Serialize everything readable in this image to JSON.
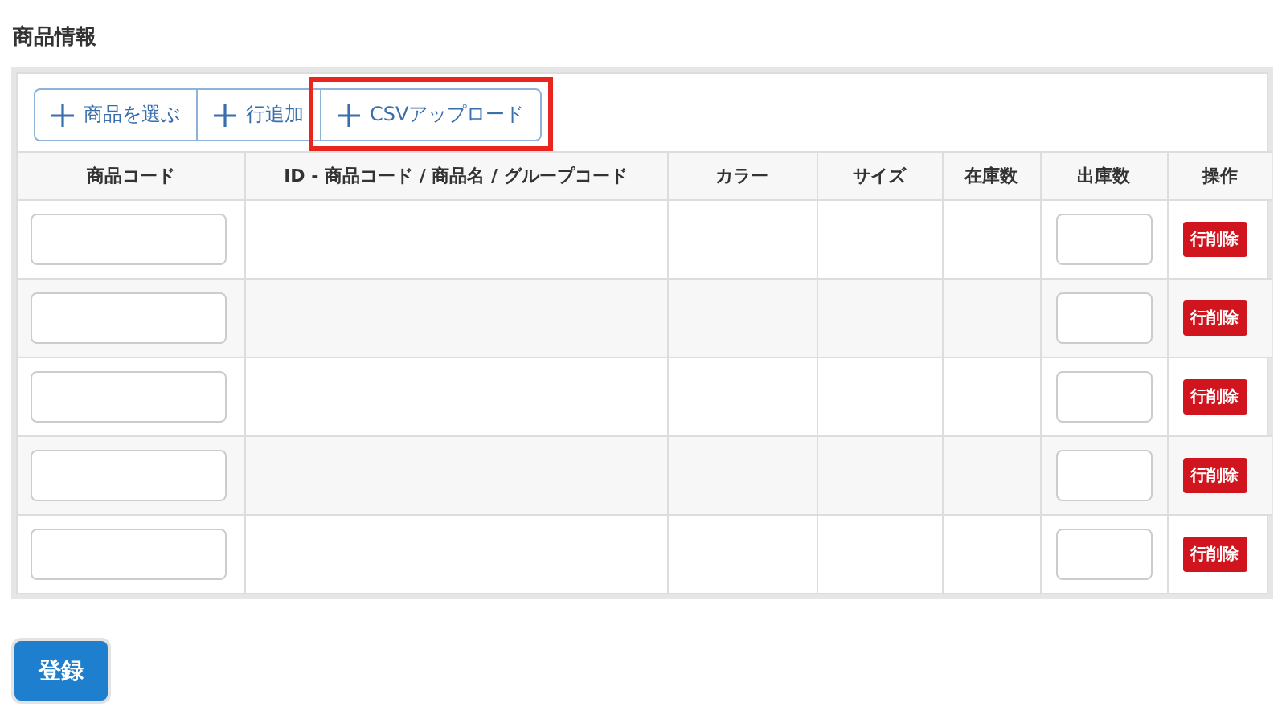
{
  "section_title": "商品情報",
  "toolbar": [
    {
      "label": "商品を選ぶ",
      "highlighted": false
    },
    {
      "label": "行追加",
      "highlighted": false
    },
    {
      "label": "CSVアップロード",
      "highlighted": true
    }
  ],
  "table": {
    "columns": [
      "商品コード",
      "ID - 商品コード / 商品名 / グループコード",
      "カラー",
      "サイズ",
      "在庫数",
      "出庫数",
      "操作"
    ],
    "rows": [
      {
        "delete_label": "行削除"
      },
      {
        "delete_label": "行削除"
      },
      {
        "delete_label": "行削除"
      },
      {
        "delete_label": "行削除"
      },
      {
        "delete_label": "行削除"
      }
    ]
  },
  "submit_button": "登録"
}
